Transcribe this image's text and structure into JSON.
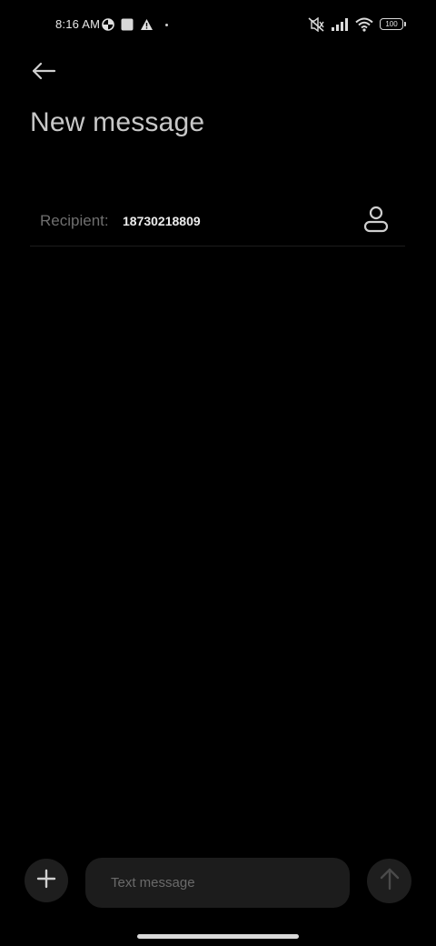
{
  "status_bar": {
    "time": "8:16 AM",
    "battery_level": "100",
    "icons": [
      "data-saver-icon",
      "square-notification-icon",
      "warning-icon",
      "dot-icon",
      "mute-icon",
      "signal-icon",
      "wifi-icon",
      "battery-icon"
    ]
  },
  "header": {
    "back_icon": "arrow-left-icon",
    "title": "New message"
  },
  "recipient": {
    "label": "Recipient:",
    "value": "18730218809",
    "contact_icon": "person-icon"
  },
  "composer": {
    "add_icon": "plus-icon",
    "placeholder": "Text message",
    "send_icon": "arrow-up-icon"
  },
  "colors": {
    "background": "#000000",
    "surface": "#1c1c1c",
    "title_text": "#c8c8c8",
    "muted_text": "#6f6f6f"
  }
}
